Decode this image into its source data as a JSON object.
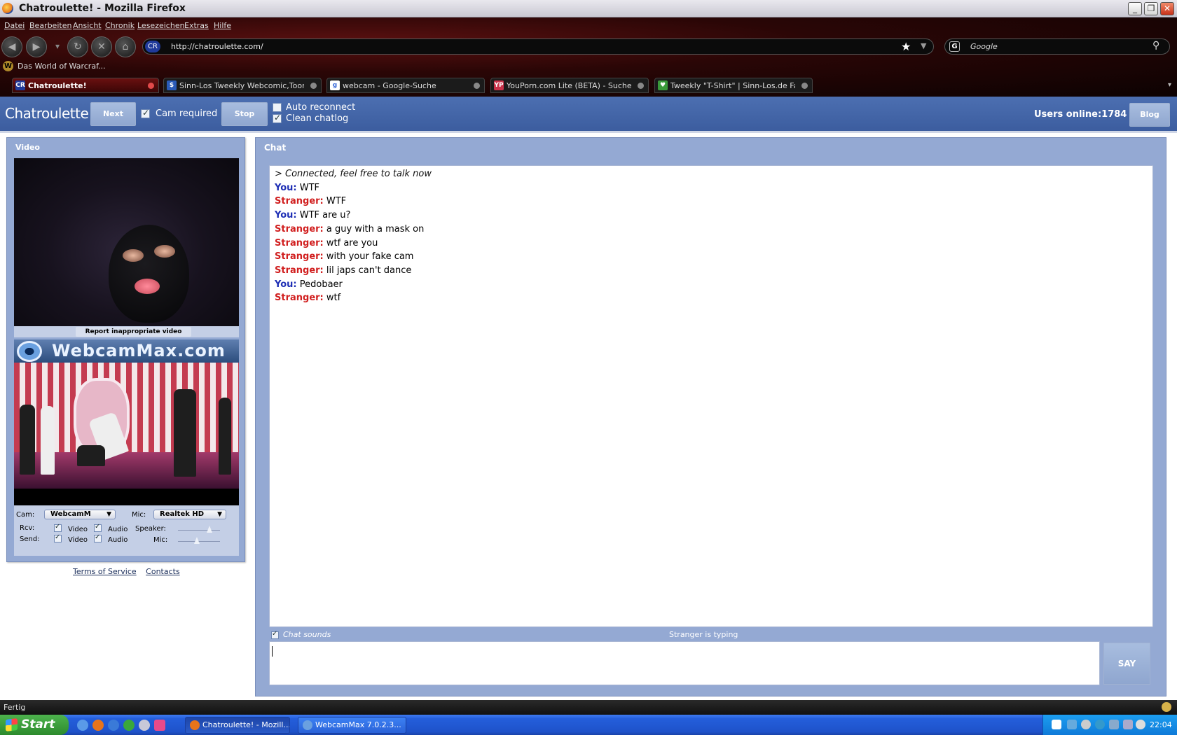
{
  "window": {
    "title": "Chatroulette! - Mozilla Firefox",
    "min_glyph": "_",
    "max_glyph": "❐",
    "close_glyph": "✕"
  },
  "menu": [
    "Datei",
    "Bearbeiten",
    "Ansicht",
    "Chronik",
    "Lesezeichen",
    "Extras",
    "Hilfe"
  ],
  "nav": {
    "back_glyph": "◀",
    "forward_glyph": "▶",
    "dropdown_glyph": "▾",
    "reload_glyph": "↻",
    "stop_glyph": "✕",
    "home_glyph": "⌂",
    "site_identity": "CR",
    "url": "http://chatroulette.com/",
    "bookmark_star": "★",
    "url_dropdown": "▼",
    "search_engine_icon": "G",
    "search_placeholder": "Google",
    "search_glyph": "⚲"
  },
  "bookmarks": {
    "icon": "W",
    "label": "Das World of Warcraf..."
  },
  "tabs": [
    {
      "favicon": "CR",
      "label": "Chatroulette!",
      "active": true,
      "fav_color": "#203a9a"
    },
    {
      "favicon": "$",
      "label": "Sinn-Los Tweekly Webcomic,Toons un...",
      "active": false,
      "fav_color": "#2a5ab8"
    },
    {
      "favicon": "g",
      "label": "webcam - Google-Suche",
      "active": false,
      "fav_color": "#ffffff"
    },
    {
      "favicon": "YP",
      "label": "YouPorn.com Lite (BETA) - Suche",
      "active": false,
      "fav_color": "#c8324a"
    },
    {
      "favicon": "♥",
      "label": "Tweekly \"T-Shirt\" | Sinn-Los.de Fan-Sh...",
      "active": false,
      "fav_color": "#3a9a3a"
    }
  ],
  "tab_scroll_glyph": "▾",
  "chatroulette": {
    "logo": "Chatroulette",
    "next_label": "Next",
    "cam_required_label": "Cam required",
    "cam_required_checked": true,
    "stop_label": "Stop",
    "auto_reconnect_label": "Auto reconnect",
    "auto_reconnect_checked": false,
    "clean_chatlog_label": "Clean chatlog",
    "clean_chatlog_checked": true,
    "users_online_label": "Users online:",
    "users_online_count": "1784",
    "blog_label": "Blog"
  },
  "video_panel": {
    "title": "Video",
    "report_label": "Report inappropriate video",
    "webcam_banner": "WebcamMax.com",
    "cam_label": "Cam:",
    "cam_value": "WebcamM",
    "mic_label": "Mic:",
    "mic_value": "Realtek HD",
    "rcv_label": "Rcv:",
    "send_label": "Send:",
    "video_label": "Video",
    "audio_label": "Audio",
    "speaker_label": "Speaker:",
    "mic_slider_label": "Mic:",
    "dropdown_glyph": "▼",
    "rcv_video_checked": true,
    "rcv_audio_checked": true,
    "send_video_checked": true,
    "send_audio_checked": true,
    "speaker_level": 0.75,
    "mic_level": 0.45
  },
  "footer": {
    "terms": "Terms of Service",
    "contacts": "Contacts"
  },
  "chat": {
    "title": "Chat",
    "messages": [
      {
        "type": "system",
        "text": "> Connected, feel free to talk now"
      },
      {
        "type": "you",
        "who": "You:",
        "text": "WTF"
      },
      {
        "type": "stranger",
        "who": "Stranger:",
        "text": "WTF"
      },
      {
        "type": "you",
        "who": "You:",
        "text": "WTF are u?"
      },
      {
        "type": "stranger",
        "who": "Stranger:",
        "text": "a guy with a mask on"
      },
      {
        "type": "stranger",
        "who": "Stranger:",
        "text": "wtf are you"
      },
      {
        "type": "stranger",
        "who": "Stranger:",
        "text": "with your fake cam"
      },
      {
        "type": "stranger",
        "who": "Stranger:",
        "text": "lil japs can't dance"
      },
      {
        "type": "you",
        "who": "You:",
        "text": "Pedobaer"
      },
      {
        "type": "stranger",
        "who": "Stranger:",
        "text": "wtf"
      }
    ],
    "chat_sounds_label": "Chat sounds",
    "chat_sounds_checked": true,
    "typing_status": "Stranger is typing",
    "input_value": "",
    "say_label": "SAY"
  },
  "statusbar": {
    "text": "Fertig"
  },
  "taskbar": {
    "start_label": "Start",
    "tasks": [
      {
        "label": "Chatroulette! - Mozill...",
        "active": true,
        "icon_color": "#e8741b"
      },
      {
        "label": "WebcamMax  7.0.2.3...",
        "active": false,
        "icon_color": "#6aa0e0"
      }
    ],
    "clock": "22:04"
  }
}
